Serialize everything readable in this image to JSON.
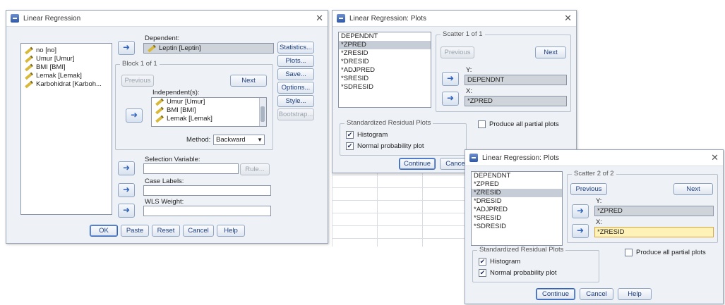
{
  "main": {
    "title": "Linear Regression",
    "vars": [
      "no [no]",
      "Umur [Umur]",
      "BMI [BMI]",
      "Lemak [Lemak]",
      "Karbohidrat [Karboh..."
    ],
    "dependent_label": "Dependent:",
    "dependent_value": "Leptin [Leptin]",
    "block_label": "Block 1 of 1",
    "previous": "Previous",
    "next": "Next",
    "independent_label": "Independent(s):",
    "independents": [
      "Umur [Umur]",
      "BMI [BMI]",
      "Lemak [Lemak]"
    ],
    "method_label": "Method:",
    "method_value": "Backward",
    "selection_label": "Selection Variable:",
    "rule": "Rule...",
    "case_label": "Case Labels:",
    "wls_label": "WLS Weight:",
    "side_buttons": [
      "Statistics...",
      "Plots...",
      "Save...",
      "Options...",
      "Style...",
      "Bootstrap..."
    ],
    "bottom_buttons": [
      "OK",
      "Paste",
      "Reset",
      "Cancel",
      "Help"
    ]
  },
  "plots1": {
    "title": "Linear Regression: Plots",
    "list": [
      "DEPENDNT",
      "*ZPRED",
      "*ZRESID",
      "*DRESID",
      "*ADJPRED",
      "*SRESID",
      "*SDRESID"
    ],
    "scatter_label": "Scatter 1 of 1",
    "previous": "Previous",
    "next": "Next",
    "y_label": "Y:",
    "y_value": "DEPENDNT",
    "x_label": "X:",
    "x_value": "*ZPRED",
    "std_group": "Standardized Residual Plots",
    "histogram": "Histogram",
    "normal": "Normal probability plot",
    "partial": "Produce all partial plots",
    "continue": "Continue",
    "cancel": "Cancel"
  },
  "plots2": {
    "title": "Linear Regression: Plots",
    "list": [
      "DEPENDNT",
      "*ZPRED",
      "*ZRESID",
      "*DRESID",
      "*ADJPRED",
      "*SRESID",
      "*SDRESID"
    ],
    "scatter_label": "Scatter 2 of 2",
    "previous": "Previous",
    "next": "Next",
    "y_label": "Y:",
    "y_value": "*ZPRED",
    "x_label": "X:",
    "x_value": "*ZRESID",
    "std_group": "Standardized Residual Plots",
    "histogram": "Histogram",
    "normal": "Normal probability plot",
    "partial": "Produce all partial plots",
    "continue": "Continue",
    "cancel": "Cancel",
    "help": "Help"
  }
}
